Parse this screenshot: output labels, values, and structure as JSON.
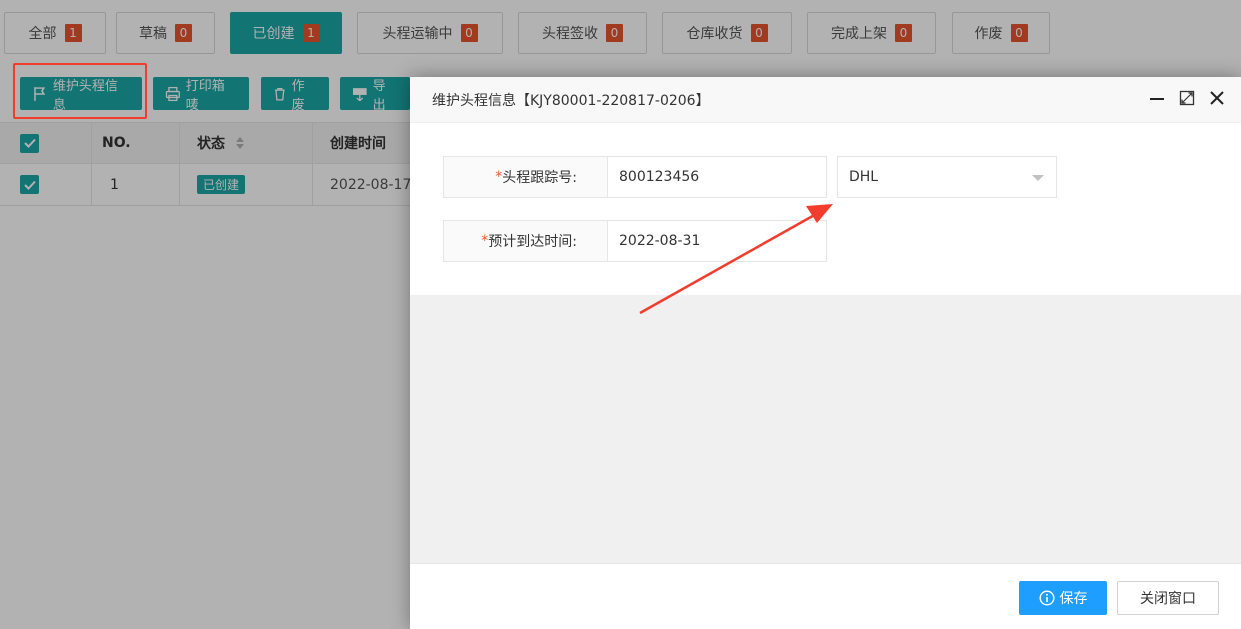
{
  "tabs": [
    {
      "label": "全部",
      "count": "1"
    },
    {
      "label": "草稿",
      "count": "0"
    },
    {
      "label": "已创建",
      "count": "1"
    },
    {
      "label": "头程运输中",
      "count": "0"
    },
    {
      "label": "头程签收",
      "count": "0"
    },
    {
      "label": "仓库收货",
      "count": "0"
    },
    {
      "label": "完成上架",
      "count": "0"
    },
    {
      "label": "作废",
      "count": "0"
    }
  ],
  "toolbar": {
    "maintain_label": "维护头程信息",
    "print_label": "打印箱唛",
    "void_label": "作废",
    "export_label": "导出"
  },
  "grid": {
    "headers": [
      "NO.",
      "状态",
      "创建时间"
    ],
    "rows": [
      {
        "no": "1",
        "status": "已创建",
        "created": "2022-08-17"
      }
    ]
  },
  "modal": {
    "title": "维护头程信息【KJY80001-220817-0206】",
    "fields": {
      "tracking_label": "头程跟踪号:",
      "tracking_value": "800123456",
      "carrier_value": "DHL",
      "eta_label": "预计到达时间:",
      "eta_value": "2022-08-31",
      "required_mark": "*"
    },
    "save_label": "保存",
    "close_label": "关闭窗口"
  },
  "colors": {
    "accent": "#1ba6a5",
    "badge": "#e8532e",
    "primary_button": "#1e9fff",
    "highlight": "#f23c2c"
  }
}
